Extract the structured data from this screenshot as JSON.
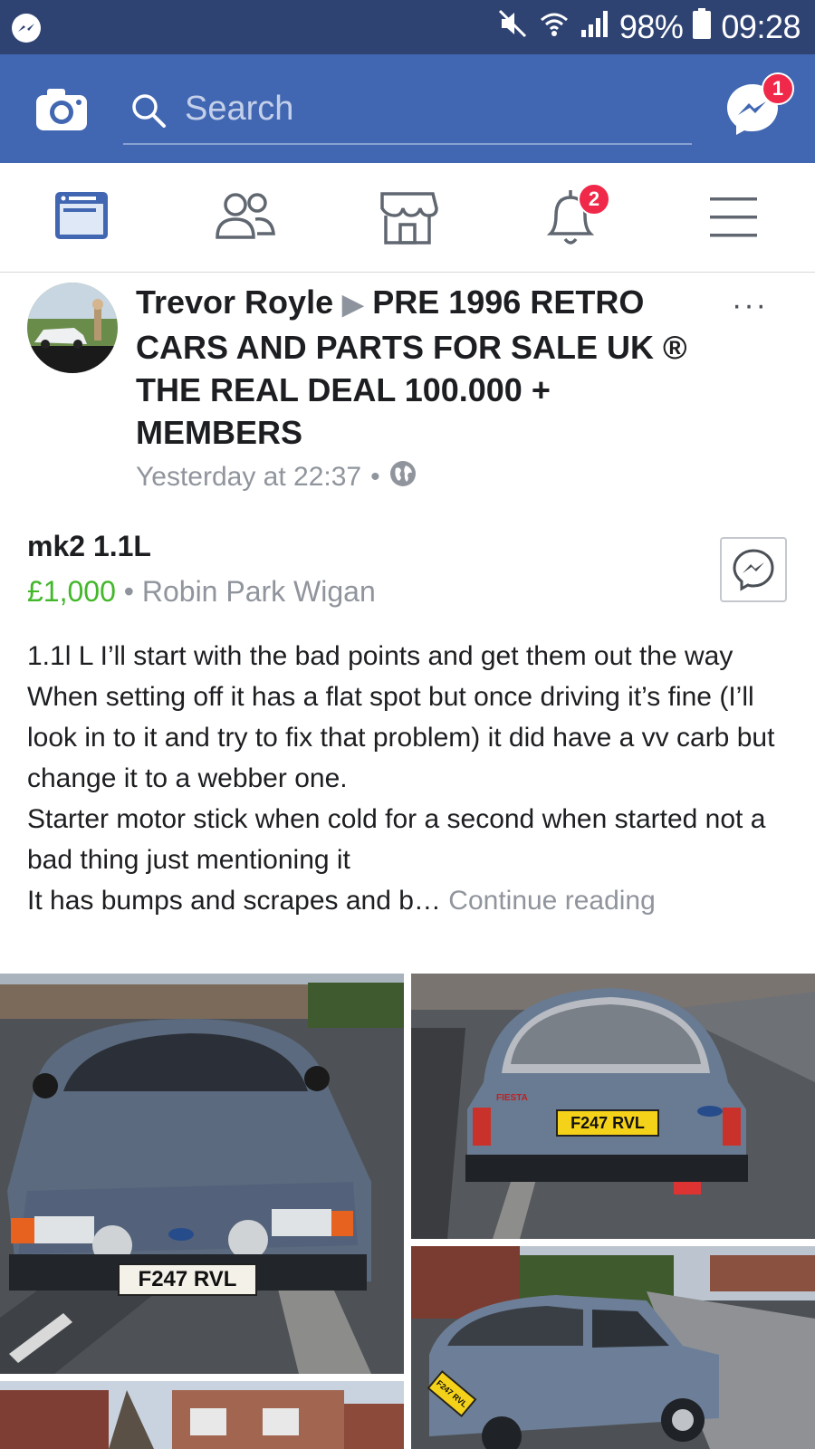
{
  "status_bar": {
    "battery": "98%",
    "time": "09:28",
    "icons": [
      "messenger-icon",
      "mute-icon",
      "wifi-icon",
      "signal-icon",
      "battery-icon"
    ]
  },
  "top_bar": {
    "search_placeholder": "Search",
    "messenger_badge": "1",
    "icons": [
      "camera-icon",
      "search-icon",
      "messenger-icon"
    ]
  },
  "nav": {
    "tabs": [
      "news-feed-icon",
      "friends-icon",
      "marketplace-icon",
      "notifications-icon",
      "menu-icon"
    ],
    "notifications_badge": "2",
    "active_tab": "news-feed",
    "accent": "#4267b2"
  },
  "post": {
    "author": "Trevor Royle",
    "arrow": "▶",
    "group": "PRE 1996 RETRO CARS AND PARTS FOR SALE UK ® THE REAL DEAL 100.000 + MEMBERS",
    "timestamp": "Yesterday at 22:37",
    "separator": "•",
    "more": "···",
    "listing": {
      "title": "mk2 1.1L",
      "price": "£1,000",
      "location": "Robin Park Wigan",
      "dot": "•"
    },
    "description": [
      "1.1l L I’ll start with the bad points and get them out the way",
      "When setting off it has a flat spot but once driving it’s fine (I’ll look in to it and try to fix that problem) it did have a vv carb but change it to a webber one.",
      "Starter motor stick when cold for a second when started not a bad thing just mentioning it",
      "It has bumps and scrapes and b…"
    ],
    "continue_reading": "Continue reading",
    "plates": [
      "F247 RVL",
      "F247 RVL",
      "F247 RVL"
    ],
    "car_badge": "FIESTA"
  },
  "colors": {
    "status_bar": "#2f4373",
    "top_bar": "#4267b2",
    "price": "#42b72a",
    "badge": "#f02849",
    "meta_text": "#90949c"
  }
}
